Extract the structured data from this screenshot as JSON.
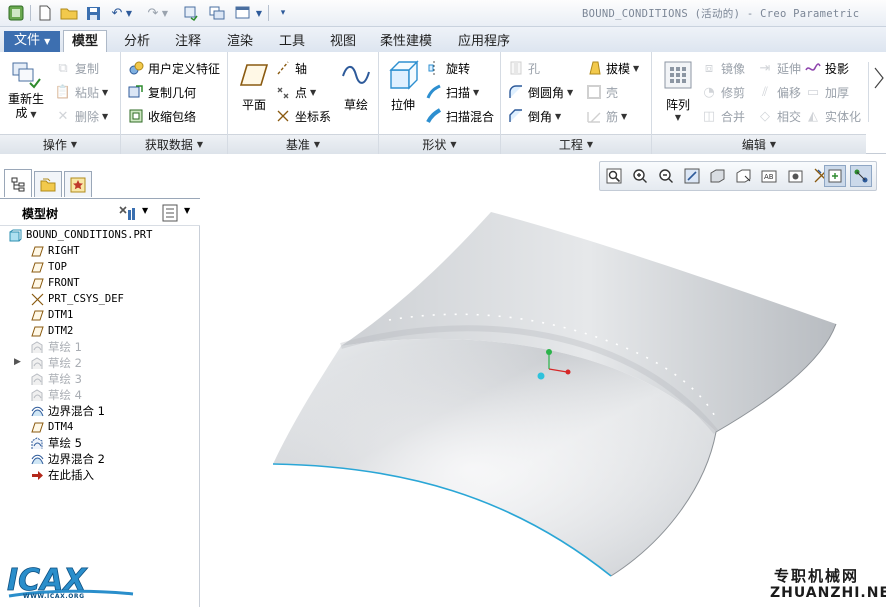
{
  "window": {
    "title": "BOUND_CONDITIONS (活动的) - Creo Parametric"
  },
  "tabs": [
    "文件",
    "模型",
    "分析",
    "注释",
    "渲染",
    "工具",
    "视图",
    "柔性建模",
    "应用程序"
  ],
  "active_tab": "模型",
  "ribbon": {
    "operations": {
      "regenerate": "重新生",
      "regenerate2": "成",
      "copy": "复制",
      "paste": "粘贴",
      "delete": "删除",
      "footer": "操作"
    },
    "get_data": {
      "udf": "用户定义特征",
      "copy_geom": "复制几何",
      "shrinkwrap": "收缩包络",
      "footer": "获取数据"
    },
    "datum": {
      "plane": "平面",
      "axis": "轴",
      "point": "点",
      "csys": "坐标系",
      "sketch": "草绘",
      "footer": "基准"
    },
    "shapes": {
      "extrude": "拉伸",
      "revolve": "旋转",
      "sweep": "扫描",
      "swept_blend": "扫描混合",
      "footer": "形状"
    },
    "engineering": {
      "hole": "孔",
      "round": "倒圆角",
      "chamfer": "倒角",
      "draft": "拔模",
      "shell": "壳",
      "rib": "筋",
      "footer": "工程"
    },
    "editing": {
      "pattern": "阵列",
      "mirror": "镜像",
      "trim": "修剪",
      "merge": "合并",
      "extend": "延伸",
      "offset": "偏移",
      "intersect": "相交",
      "project": "投影",
      "thicken": "加厚",
      "solidify": "实体化",
      "footer": "编辑"
    }
  },
  "model_tree": {
    "header": "模型树",
    "items": [
      {
        "label": "BOUND_CONDITIONS.PRT",
        "icon": "part-icon",
        "state": "normal"
      },
      {
        "label": "RIGHT",
        "icon": "datum-plane-icon",
        "state": "normal"
      },
      {
        "label": "TOP",
        "icon": "datum-plane-icon",
        "state": "normal"
      },
      {
        "label": "FRONT",
        "icon": "datum-plane-icon",
        "state": "normal"
      },
      {
        "label": "PRT_CSYS_DEF",
        "icon": "csys-icon",
        "state": "normal"
      },
      {
        "label": "DTM1",
        "icon": "datum-plane-icon",
        "state": "normal"
      },
      {
        "label": "DTM2",
        "icon": "datum-plane-icon",
        "state": "normal"
      },
      {
        "label": "草绘 1",
        "icon": "sketch-icon",
        "state": "hidden"
      },
      {
        "label": "草绘 2",
        "icon": "sketch-icon",
        "state": "hidden"
      },
      {
        "label": "草绘 3",
        "icon": "sketch-icon",
        "state": "hidden"
      },
      {
        "label": "草绘 4",
        "icon": "sketch-icon",
        "state": "hidden"
      },
      {
        "label": "边界混合 1",
        "icon": "boundary-blend-icon",
        "state": "normal"
      },
      {
        "label": "DTM4",
        "icon": "datum-plane-icon",
        "state": "normal"
      },
      {
        "label": "草绘 5",
        "icon": "sketch-icon",
        "state": "normal"
      },
      {
        "label": "边界混合 2",
        "icon": "boundary-blend-icon",
        "state": "normal"
      },
      {
        "label": "在此插入",
        "icon": "insert-here-arrow-icon",
        "state": "normal"
      }
    ]
  },
  "watermarks": {
    "left": "ICAX",
    "left_sub": "WWW.ICAX.ORG",
    "right_cn": "专职机械网",
    "right_en": "ZHUANZHI.NET"
  },
  "colors": {
    "accent_tab": "#ffffff",
    "edge_blue": "#2aa6d6",
    "surface": "#d6d8db",
    "insert_arrow": "#b3281b"
  }
}
